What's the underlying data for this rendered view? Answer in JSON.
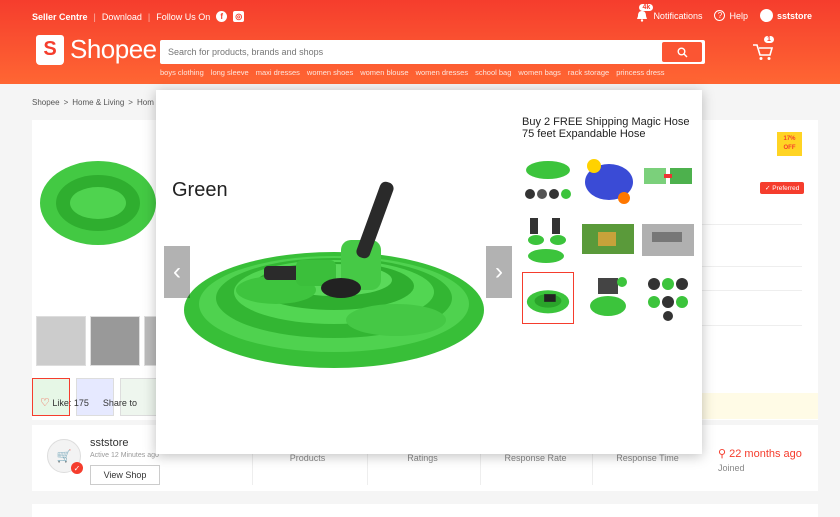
{
  "topbar": {
    "seller_centre": "Seller Centre",
    "download": "Download",
    "follow_us": "Follow Us On",
    "notifications": "Notifications",
    "notifications_count": "4k",
    "help": "Help",
    "username": "sststore"
  },
  "header": {
    "logo_text": "Shopee",
    "search_placeholder": "Search for products, brands and shops",
    "cart_count": "1",
    "keywords": [
      "boys clothing",
      "long sleeve",
      "maxi dresses",
      "women shoes",
      "women blouse",
      "women dresses",
      "school bag",
      "women bags",
      "rack storage",
      "princess dress"
    ]
  },
  "breadcrumb": [
    "Shopee",
    ">",
    "Home & Living",
    ">",
    "Hom"
  ],
  "product": {
    "discount_pct": "17%",
    "discount_off": "OFF",
    "preferred": "Preferred",
    "likes": "Like: 175",
    "share": "Share to"
  },
  "modal": {
    "title": "Buy 2 FREE Shipping Magic Hose 75 feet Expandable Hose",
    "image_caption": "Green"
  },
  "shop": {
    "name": "sststore",
    "active": "Active 12 Minutes ago",
    "view_shop": "View Shop",
    "stats": [
      {
        "label": "Products"
      },
      {
        "label": "Ratings"
      },
      {
        "label": "Response Rate"
      },
      {
        "label": "Response Time"
      }
    ],
    "joined_value": "22 months ago",
    "joined_label": "Joined"
  },
  "colors": {
    "brand": "#f53d2d",
    "hose_green": "#3cc43c",
    "nozzle_dark": "#2a2a2a"
  }
}
